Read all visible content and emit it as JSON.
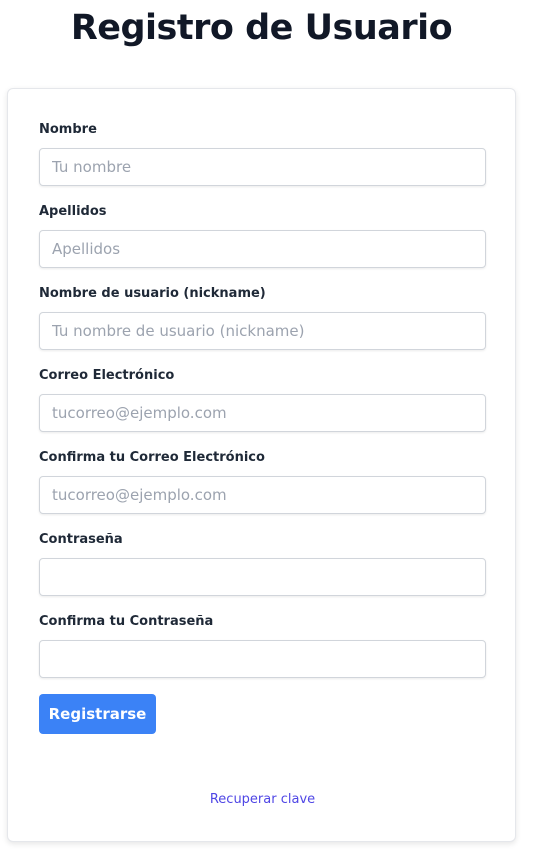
{
  "page": {
    "title": "Registro de Usuario"
  },
  "form": {
    "fields": [
      {
        "label": "Nombre",
        "placeholder": "Tu nombre",
        "type": "text"
      },
      {
        "label": "Apellidos",
        "placeholder": "Apellidos",
        "type": "text"
      },
      {
        "label": "Nombre de usuario (nickname)",
        "placeholder": "Tu nombre de usuario (nickname)",
        "type": "text"
      },
      {
        "label": "Correo Electrónico",
        "placeholder": "tucorreo@ejemplo.com",
        "type": "email"
      },
      {
        "label": "Confirma tu Correo Electrónico",
        "placeholder": "tucorreo@ejemplo.com",
        "type": "email"
      },
      {
        "label": "Contraseña",
        "placeholder": "",
        "type": "password"
      },
      {
        "label": "Confirma tu Contraseña",
        "placeholder": "",
        "type": "password"
      }
    ],
    "submit_label": "Registrarse",
    "recover_link": "Recuperar clave"
  },
  "colors": {
    "primary_button": "#3b82f6",
    "link": "#4f46e5",
    "title": "#111827"
  }
}
